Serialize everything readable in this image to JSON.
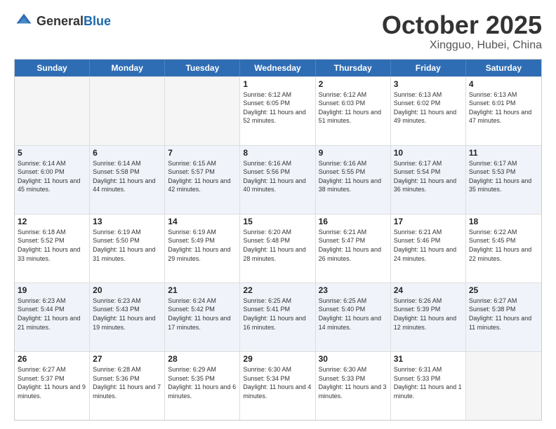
{
  "header": {
    "logo_general": "General",
    "logo_blue": "Blue",
    "month": "October 2025",
    "location": "Xingguo, Hubei, China"
  },
  "weekdays": [
    "Sunday",
    "Monday",
    "Tuesday",
    "Wednesday",
    "Thursday",
    "Friday",
    "Saturday"
  ],
  "rows": [
    [
      {
        "day": "",
        "sunrise": "",
        "sunset": "",
        "daylight": "",
        "empty": true
      },
      {
        "day": "",
        "sunrise": "",
        "sunset": "",
        "daylight": "",
        "empty": true
      },
      {
        "day": "",
        "sunrise": "",
        "sunset": "",
        "daylight": "",
        "empty": true
      },
      {
        "day": "1",
        "sunrise": "Sunrise: 6:12 AM",
        "sunset": "Sunset: 6:05 PM",
        "daylight": "Daylight: 11 hours and 52 minutes.",
        "empty": false
      },
      {
        "day": "2",
        "sunrise": "Sunrise: 6:12 AM",
        "sunset": "Sunset: 6:03 PM",
        "daylight": "Daylight: 11 hours and 51 minutes.",
        "empty": false
      },
      {
        "day": "3",
        "sunrise": "Sunrise: 6:13 AM",
        "sunset": "Sunset: 6:02 PM",
        "daylight": "Daylight: 11 hours and 49 minutes.",
        "empty": false
      },
      {
        "day": "4",
        "sunrise": "Sunrise: 6:13 AM",
        "sunset": "Sunset: 6:01 PM",
        "daylight": "Daylight: 11 hours and 47 minutes.",
        "empty": false
      }
    ],
    [
      {
        "day": "5",
        "sunrise": "Sunrise: 6:14 AM",
        "sunset": "Sunset: 6:00 PM",
        "daylight": "Daylight: 11 hours and 45 minutes.",
        "empty": false
      },
      {
        "day": "6",
        "sunrise": "Sunrise: 6:14 AM",
        "sunset": "Sunset: 5:58 PM",
        "daylight": "Daylight: 11 hours and 44 minutes.",
        "empty": false
      },
      {
        "day": "7",
        "sunrise": "Sunrise: 6:15 AM",
        "sunset": "Sunset: 5:57 PM",
        "daylight": "Daylight: 11 hours and 42 minutes.",
        "empty": false
      },
      {
        "day": "8",
        "sunrise": "Sunrise: 6:16 AM",
        "sunset": "Sunset: 5:56 PM",
        "daylight": "Daylight: 11 hours and 40 minutes.",
        "empty": false
      },
      {
        "day": "9",
        "sunrise": "Sunrise: 6:16 AM",
        "sunset": "Sunset: 5:55 PM",
        "daylight": "Daylight: 11 hours and 38 minutes.",
        "empty": false
      },
      {
        "day": "10",
        "sunrise": "Sunrise: 6:17 AM",
        "sunset": "Sunset: 5:54 PM",
        "daylight": "Daylight: 11 hours and 36 minutes.",
        "empty": false
      },
      {
        "day": "11",
        "sunrise": "Sunrise: 6:17 AM",
        "sunset": "Sunset: 5:53 PM",
        "daylight": "Daylight: 11 hours and 35 minutes.",
        "empty": false
      }
    ],
    [
      {
        "day": "12",
        "sunrise": "Sunrise: 6:18 AM",
        "sunset": "Sunset: 5:52 PM",
        "daylight": "Daylight: 11 hours and 33 minutes.",
        "empty": false
      },
      {
        "day": "13",
        "sunrise": "Sunrise: 6:19 AM",
        "sunset": "Sunset: 5:50 PM",
        "daylight": "Daylight: 11 hours and 31 minutes.",
        "empty": false
      },
      {
        "day": "14",
        "sunrise": "Sunrise: 6:19 AM",
        "sunset": "Sunset: 5:49 PM",
        "daylight": "Daylight: 11 hours and 29 minutes.",
        "empty": false
      },
      {
        "day": "15",
        "sunrise": "Sunrise: 6:20 AM",
        "sunset": "Sunset: 5:48 PM",
        "daylight": "Daylight: 11 hours and 28 minutes.",
        "empty": false
      },
      {
        "day": "16",
        "sunrise": "Sunrise: 6:21 AM",
        "sunset": "Sunset: 5:47 PM",
        "daylight": "Daylight: 11 hours and 26 minutes.",
        "empty": false
      },
      {
        "day": "17",
        "sunrise": "Sunrise: 6:21 AM",
        "sunset": "Sunset: 5:46 PM",
        "daylight": "Daylight: 11 hours and 24 minutes.",
        "empty": false
      },
      {
        "day": "18",
        "sunrise": "Sunrise: 6:22 AM",
        "sunset": "Sunset: 5:45 PM",
        "daylight": "Daylight: 11 hours and 22 minutes.",
        "empty": false
      }
    ],
    [
      {
        "day": "19",
        "sunrise": "Sunrise: 6:23 AM",
        "sunset": "Sunset: 5:44 PM",
        "daylight": "Daylight: 11 hours and 21 minutes.",
        "empty": false
      },
      {
        "day": "20",
        "sunrise": "Sunrise: 6:23 AM",
        "sunset": "Sunset: 5:43 PM",
        "daylight": "Daylight: 11 hours and 19 minutes.",
        "empty": false
      },
      {
        "day": "21",
        "sunrise": "Sunrise: 6:24 AM",
        "sunset": "Sunset: 5:42 PM",
        "daylight": "Daylight: 11 hours and 17 minutes.",
        "empty": false
      },
      {
        "day": "22",
        "sunrise": "Sunrise: 6:25 AM",
        "sunset": "Sunset: 5:41 PM",
        "daylight": "Daylight: 11 hours and 16 minutes.",
        "empty": false
      },
      {
        "day": "23",
        "sunrise": "Sunrise: 6:25 AM",
        "sunset": "Sunset: 5:40 PM",
        "daylight": "Daylight: 11 hours and 14 minutes.",
        "empty": false
      },
      {
        "day": "24",
        "sunrise": "Sunrise: 6:26 AM",
        "sunset": "Sunset: 5:39 PM",
        "daylight": "Daylight: 11 hours and 12 minutes.",
        "empty": false
      },
      {
        "day": "25",
        "sunrise": "Sunrise: 6:27 AM",
        "sunset": "Sunset: 5:38 PM",
        "daylight": "Daylight: 11 hours and 11 minutes.",
        "empty": false
      }
    ],
    [
      {
        "day": "26",
        "sunrise": "Sunrise: 6:27 AM",
        "sunset": "Sunset: 5:37 PM",
        "daylight": "Daylight: 11 hours and 9 minutes.",
        "empty": false
      },
      {
        "day": "27",
        "sunrise": "Sunrise: 6:28 AM",
        "sunset": "Sunset: 5:36 PM",
        "daylight": "Daylight: 11 hours and 7 minutes.",
        "empty": false
      },
      {
        "day": "28",
        "sunrise": "Sunrise: 6:29 AM",
        "sunset": "Sunset: 5:35 PM",
        "daylight": "Daylight: 11 hours and 6 minutes.",
        "empty": false
      },
      {
        "day": "29",
        "sunrise": "Sunrise: 6:30 AM",
        "sunset": "Sunset: 5:34 PM",
        "daylight": "Daylight: 11 hours and 4 minutes.",
        "empty": false
      },
      {
        "day": "30",
        "sunrise": "Sunrise: 6:30 AM",
        "sunset": "Sunset: 5:33 PM",
        "daylight": "Daylight: 11 hours and 3 minutes.",
        "empty": false
      },
      {
        "day": "31",
        "sunrise": "Sunrise: 6:31 AM",
        "sunset": "Sunset: 5:33 PM",
        "daylight": "Daylight: 11 hours and 1 minute.",
        "empty": false
      },
      {
        "day": "",
        "sunrise": "",
        "sunset": "",
        "daylight": "",
        "empty": true
      }
    ]
  ]
}
